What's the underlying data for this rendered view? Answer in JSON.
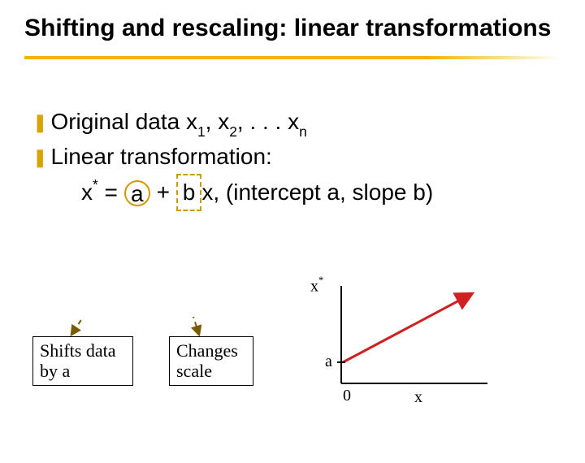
{
  "title": "Shifting and rescaling: linear transformations",
  "bullets": {
    "b1_pre": "Original data x",
    "b1_s1": "1",
    "b1_mid1": ", x",
    "b1_s2": "2",
    "b1_mid2": ", . . . x",
    "b1_s3": "n",
    "b2": "Linear transformation:"
  },
  "formula": {
    "xvar": "x",
    "star": "*",
    "eq": " = ",
    "a": "a",
    "plus": " + ",
    "b": "b",
    "xtail": "x, (intercept a, slope b)"
  },
  "annot": {
    "shifts_l1": "Shifts data",
    "shifts_l2": "by a",
    "changes_l1": "Changes",
    "changes_l2": "scale"
  },
  "chart": {
    "ylabel_x": "x",
    "ylabel_star": "*",
    "a_label": "a",
    "origin": "0",
    "xlabel": "x"
  },
  "chart_data": {
    "type": "line",
    "title": "",
    "xlabel": "x",
    "ylabel": "x*",
    "intercept_label": "a",
    "x": [
      0,
      1
    ],
    "y": [
      0.2,
      1.0
    ],
    "note": "Schematic: line x* = a + b x with positive intercept a and positive slope b; axes unscaled."
  }
}
